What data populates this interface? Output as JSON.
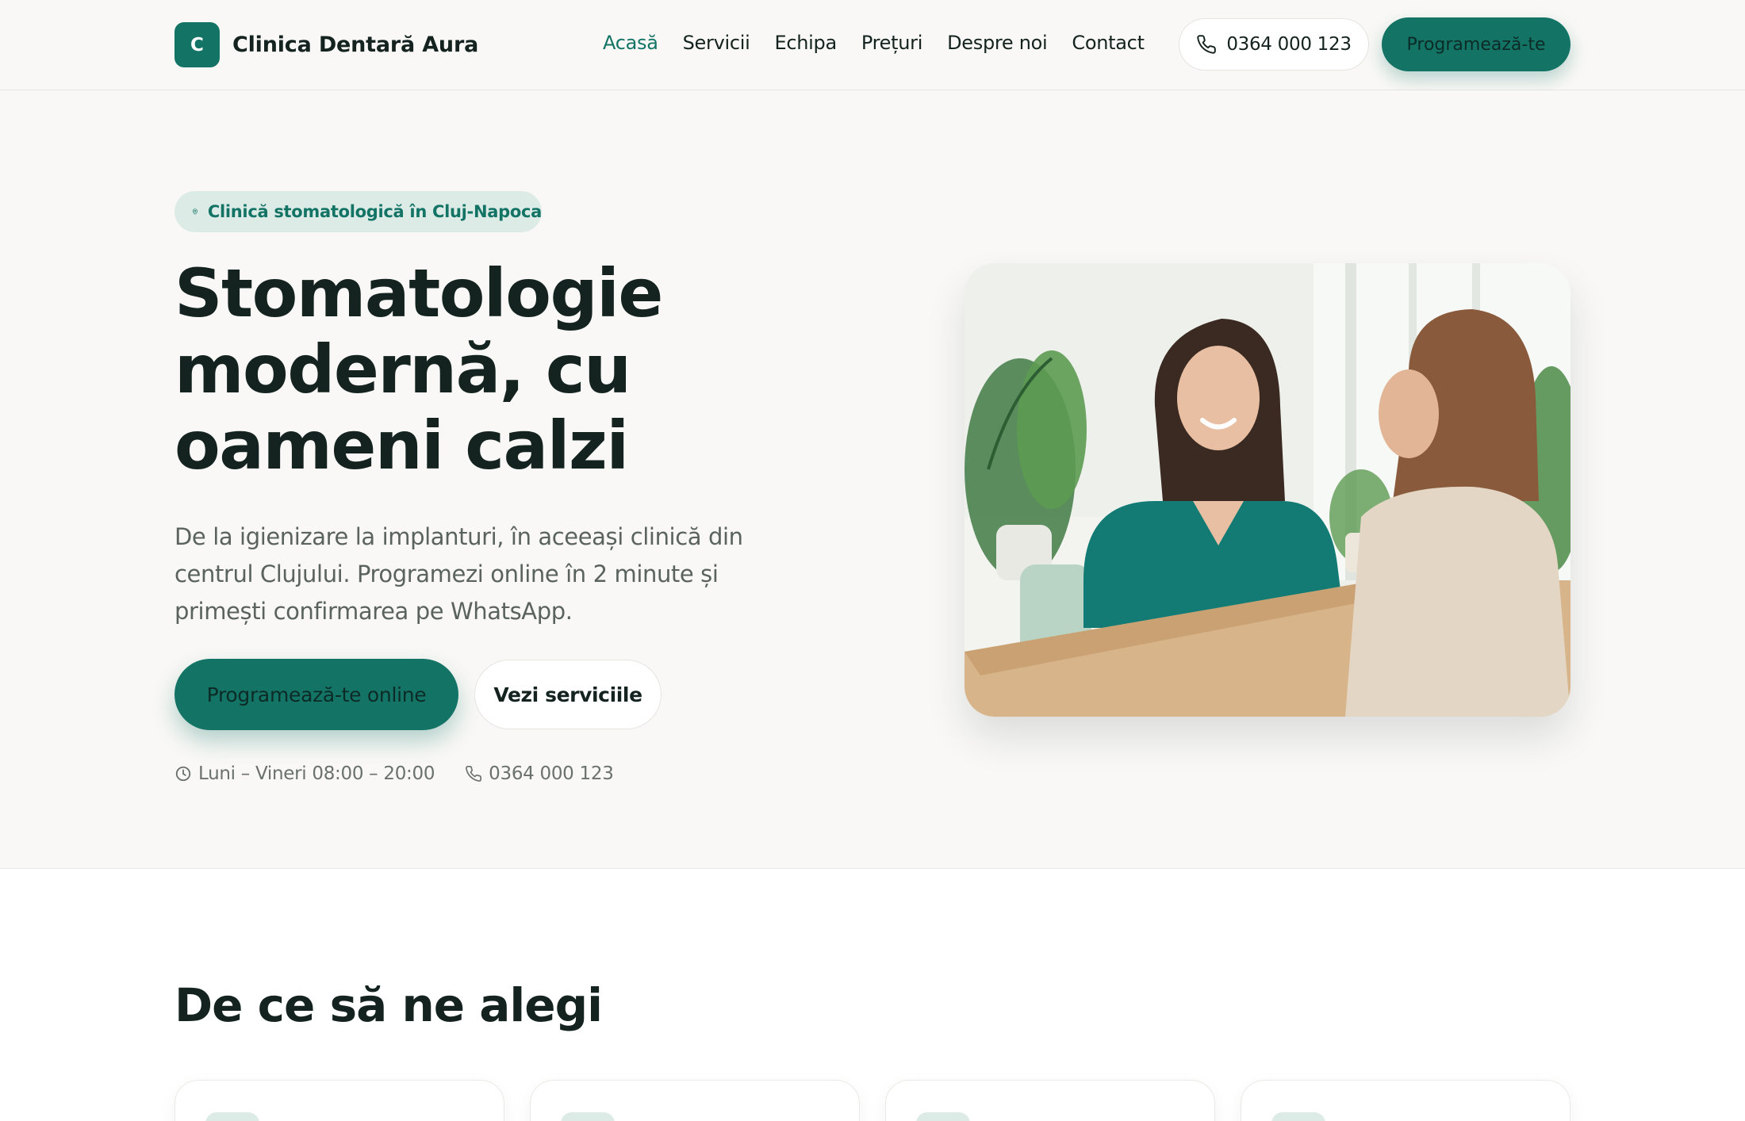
{
  "brand": {
    "logo_letter": "C",
    "name": "Clinica Dentară Aura"
  },
  "nav": {
    "items": [
      {
        "label": "Acasă",
        "active": true
      },
      {
        "label": "Servicii",
        "active": false
      },
      {
        "label": "Echipa",
        "active": false
      },
      {
        "label": "Prețuri",
        "active": false
      },
      {
        "label": "Despre noi",
        "active": false
      },
      {
        "label": "Contact",
        "active": false
      }
    ],
    "phone": "0364 000 123",
    "cta": "Programează-te"
  },
  "hero": {
    "badge": "Clinică stomatologică în Cluj-Napoca",
    "title": "Stomatologie modernă, cu oameni calzi",
    "description": "De la igienizare la implanturi, în aceeași clinică din centrul Clujului. Programezi online în 2 minute și primești confirmarea pe WhatsApp.",
    "primary_button": "Programează-te online",
    "secondary_button": "Vezi serviciile",
    "hours": "Luni – Vineri 08:00 – 20:00",
    "phone": "0364 000 123"
  },
  "features": {
    "title": "De ce să ne alegi"
  },
  "colors": {
    "accent": "#137466",
    "accent_soft": "#dcebe6",
    "text": "#14231f",
    "muted": "#5b635f",
    "background": "#f9f8f6"
  }
}
